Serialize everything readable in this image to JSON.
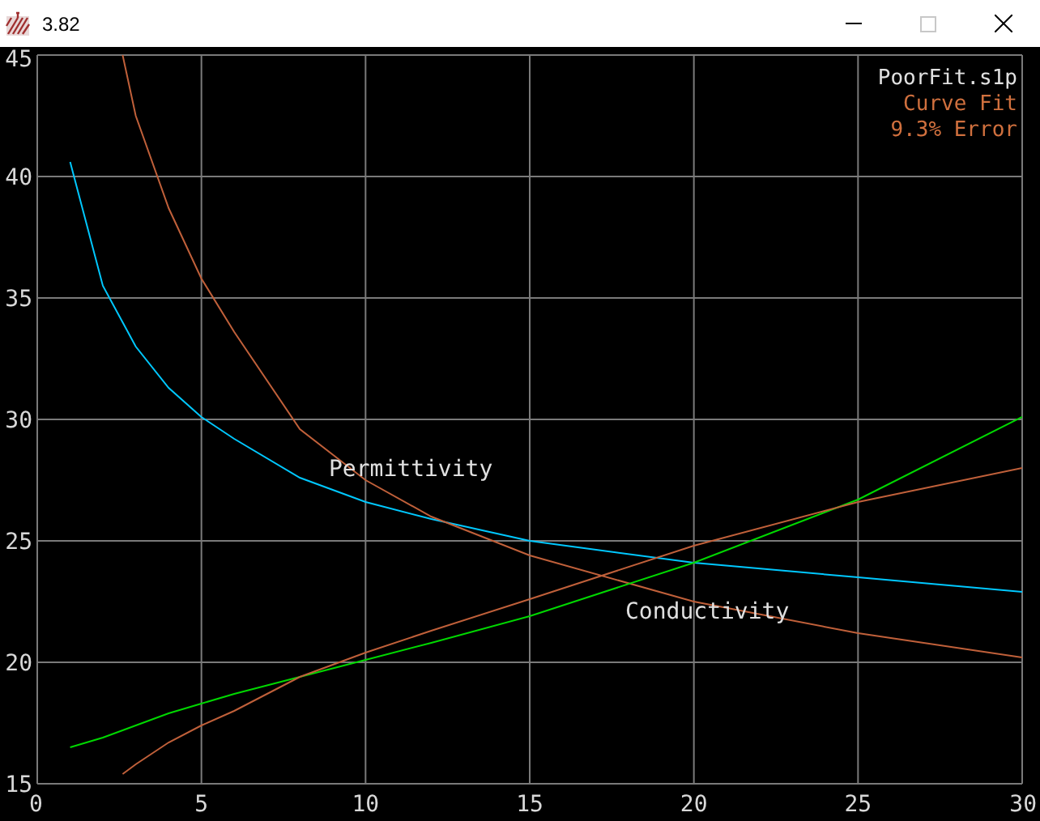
{
  "window": {
    "title": "3.82",
    "maximize_disabled": true
  },
  "chart_data": {
    "type": "line",
    "xlim": [
      0,
      30
    ],
    "ylim": [
      15,
      45
    ],
    "xticks": [
      0,
      5,
      10,
      15,
      20,
      25,
      30
    ],
    "yticks": [
      15,
      20,
      25,
      30,
      35,
      40,
      45
    ],
    "x": [
      1,
      2,
      2.6,
      3,
      4,
      5,
      6,
      8,
      10,
      12,
      15,
      20,
      25,
      30
    ],
    "series": [
      {
        "name": "Permittivity",
        "color": "#00c8ff",
        "values": [
          40.6,
          35.5,
          34.0,
          33.0,
          31.3,
          30.1,
          29.2,
          27.6,
          26.6,
          25.9,
          25.0,
          24.1,
          23.5,
          22.9
        ]
      },
      {
        "color": "#c0603a",
        "values": [
          null,
          null,
          45.0,
          42.5,
          38.7,
          35.8,
          33.6,
          29.6,
          27.5,
          26.0,
          24.4,
          22.5,
          21.2,
          20.2
        ]
      },
      {
        "name": "Conductivity",
        "color": "#00d800",
        "values": [
          16.5,
          16.9,
          17.2,
          17.4,
          17.9,
          18.3,
          18.7,
          19.4,
          20.1,
          20.8,
          21.9,
          24.1,
          26.7,
          30.1
        ]
      },
      {
        "color": "#c0603a",
        "values": [
          null,
          null,
          15.4,
          15.8,
          16.7,
          17.4,
          18.0,
          19.4,
          20.4,
          21.3,
          22.6,
          24.8,
          26.6,
          28.0
        ]
      }
    ],
    "grid": true
  },
  "legend": [
    {
      "text": "PoorFit.s1p",
      "color": "#e0e0e0"
    },
    {
      "text": "Curve Fit",
      "color": "#d0703e"
    },
    {
      "text": "9.3% Error",
      "color": "#d0703e"
    }
  ]
}
